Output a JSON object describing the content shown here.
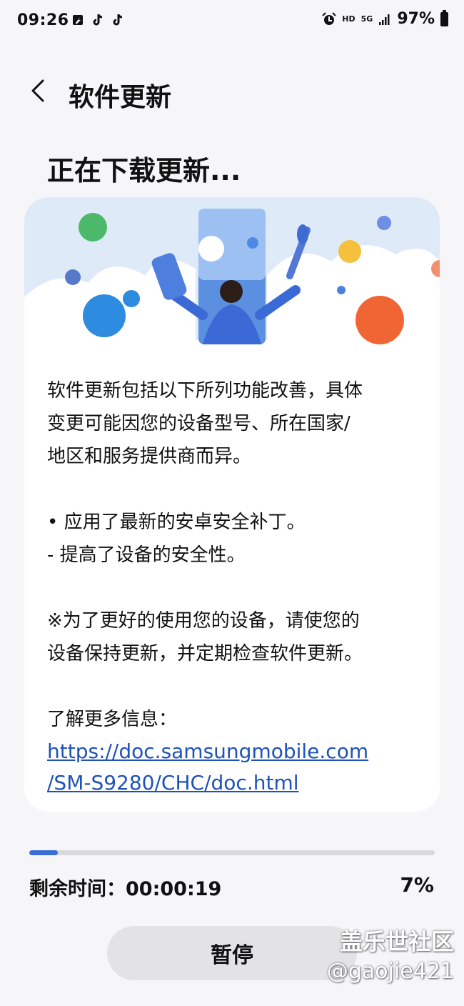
{
  "status_bar": {
    "time": "09:26",
    "network_hd": "HD",
    "network_5g": "5G",
    "battery_percent": "97%"
  },
  "header": {
    "title": "软件更新"
  },
  "page": {
    "heading": "正在下载更新..."
  },
  "card": {
    "intro_line_1": "软件更新包括以下所列功能改善，具体",
    "intro_line_2": "变更可能因您的设备型号、所在国家/",
    "intro_line_3": "地区和服务提供商而异。",
    "bullet_1": "• 应用了最新的安卓安全补丁。",
    "bullet_2": " - 提高了设备的安全性。",
    "note_line_1": "※为了更好的使用您的设备，请使您的",
    "note_line_2": "设备保持更新，并定期检查软件更新。",
    "more_info": "了解更多信息：",
    "link_line_1": "https://doc.samsungmobile.com",
    "link_line_2": "/SM-S9280/CHC/doc.html"
  },
  "progress": {
    "value": 0.07,
    "remaining_label": "剩余时间：",
    "remaining_time": "00:00:19",
    "percent_text": "7%"
  },
  "actions": {
    "pause_label": "暂停"
  },
  "watermark": {
    "brand": "盖乐世社区",
    "user": "@gaojie421"
  },
  "colors": {
    "accent": "#3a6fd8",
    "link": "#1f52b8",
    "background": "#f6f6f8",
    "card": "#ffffff"
  },
  "icons": {
    "back": "chevron-left-icon",
    "battery": "battery-icon",
    "alarm": "alarm-icon",
    "signal": "signal-icon"
  }
}
